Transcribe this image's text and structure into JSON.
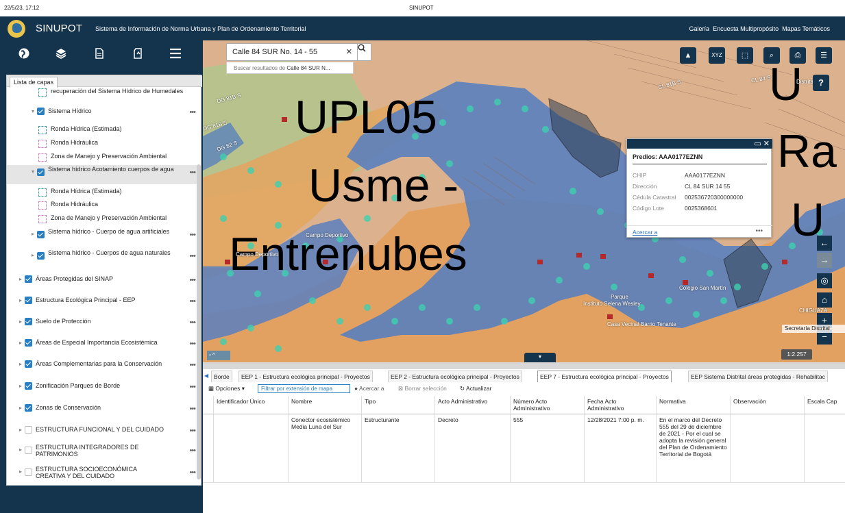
{
  "print_header": {
    "datetime": "22/5/23, 17:12",
    "title": "SINUPOT"
  },
  "topbar": {
    "app_title": "SINUPOT",
    "subtitle": "Sistema de Información de Norma Urbana y Plan de Ordenamiento Territorial",
    "links": [
      "Galería",
      "Encuesta Multipropósito",
      "Mapas Temáticos"
    ]
  },
  "sidebar": {
    "icons": [
      "globe-icon",
      "layers-icon",
      "document-icon",
      "bookmark-icon",
      "menu-icon"
    ],
    "tab_label": "Lista de capas",
    "layers": [
      {
        "label": "recuperación del Sistema Hídrico de Humedales",
        "kind": "symbol"
      },
      {
        "label": "Sistema Hídrico",
        "kind": "group"
      },
      {
        "label": "Ronda Hídrica (Estimada)",
        "kind": "symbol"
      },
      {
        "label": "Ronda Hidráulica",
        "kind": "symbol"
      },
      {
        "label": "Zona de Manejo y Preservación Ambiental",
        "kind": "symbol"
      },
      {
        "label": "Sistema hídrico Acotamiento cuerpos de agua",
        "kind": "group"
      },
      {
        "label": "Ronda Hídrica (Estimada)",
        "kind": "symbol"
      },
      {
        "label": "Ronda Hidráulica",
        "kind": "symbol"
      },
      {
        "label": "Zona de Manejo y Preservación Ambiental",
        "kind": "symbol"
      },
      {
        "label": "Sistema hídrico - Cuerpo de agua artificiales",
        "kind": "group"
      },
      {
        "label": "Sistema hídrico - Cuerpos de agua naturales",
        "kind": "group"
      },
      {
        "label": "Áreas Protegidas del SINAP",
        "kind": "group"
      },
      {
        "label": "Estructura Ecológica Principal - EEP",
        "kind": "group"
      },
      {
        "label": "Suelo de Protección",
        "kind": "group"
      },
      {
        "label": "Áreas de Especial Importancia Ecosistémica",
        "kind": "group"
      },
      {
        "label": "Áreas Complementarias para la Conservación",
        "kind": "group"
      },
      {
        "label": "Zonificación Parques de Borde",
        "kind": "group"
      },
      {
        "label": "Zonas de Conservación",
        "kind": "group"
      },
      {
        "label": "ESTRUCTURA FUNCIONAL Y DEL CUIDADO",
        "kind": "top"
      },
      {
        "label": "ESTRUCTURA INTEGRADORES DE PATRIMONIOS",
        "kind": "top"
      },
      {
        "label": "ESTRUCTURA SOCIOECONÓMICA CREATIVA Y DEL CUIDADO",
        "kind": "top"
      }
    ]
  },
  "map": {
    "search_value": "Calle 84 SUR No. 14 - 55",
    "search_suggestion_prefix": "Buscar resultados de ",
    "search_suggestion_term": "Calle 84 SUR N...",
    "upz_label_lines": [
      "UPL05",
      "Usme -",
      "Entrenubes"
    ],
    "edge_label_lines": [
      "U",
      "Ra",
      "U"
    ],
    "place_labels": [
      "Campo Deportivo",
      "Campo Deportivo",
      "Colegio San Martín",
      "Instituto Selena Wesley",
      "Casa Vecinal Barrio Tenante",
      "Parque",
      "DG 81B S",
      "DG 81B S",
      "CL 81B S",
      "DG 82 S",
      "CL 84 S",
      "Distrital",
      "CHIGUAZA"
    ],
    "tool_icons": [
      "upload-icon",
      "xyz-icon",
      "select-icon",
      "zoom-search-icon",
      "print-icon",
      "report-icon"
    ],
    "help_label": "?",
    "attribution": "Secretaría Distrital",
    "scale": "1:2.257",
    "popup": {
      "title": "Predios: AAA0177EZNN",
      "fields": [
        {
          "label": "CHIP",
          "value": "AAA0177EZNN"
        },
        {
          "label": "Dirección",
          "value": "CL 84 SUR 14 55"
        },
        {
          "label": "Cédula Catastral",
          "value": "002536720300000000"
        },
        {
          "label": "Código Lote",
          "value": "0025368601"
        }
      ],
      "zoom_link": "Acercar a",
      "more": "•••"
    }
  },
  "table": {
    "tabs": [
      {
        "label": "Borde",
        "active": false
      },
      {
        "label": "EEP 1 - Estructura ecológica principal - Proyectos",
        "active": false
      },
      {
        "label": "EEP 2 - Estructura ecológica principal - Proyectos",
        "active": false
      },
      {
        "label": "EEP 7 - Estructura ecológica principal - Proyectos",
        "active": true
      },
      {
        "label": "EEP Sistema Distrital áreas protegidas - Rehabilitac",
        "active": false
      }
    ],
    "toolbar": {
      "options": "Opciones",
      "filter": "Filtrar por extensión de mapa",
      "zoom": "Acercar a",
      "clear": "Borrar selección",
      "refresh": "Actualizar"
    },
    "columns": [
      "Identificador Único",
      "Nombre",
      "Tipo",
      "Acto Administrativo",
      "Número Acto Administrativo",
      "Fecha Acto Administrativo",
      "Normativa",
      "Observación",
      "Escala Cap"
    ],
    "rows": [
      [
        "",
        "Conector ecosistémico Media Luna del Sur",
        "Estructurante",
        "Decreto",
        "555",
        "12/28/2021 7:00 p. m.",
        "En el marco del Decreto 555 del 29 de diciembre de 2021 - Por el cual se adopta la revisión general del Plan de Ordenamiento Territorial de Bogotá",
        "",
        ""
      ]
    ]
  }
}
